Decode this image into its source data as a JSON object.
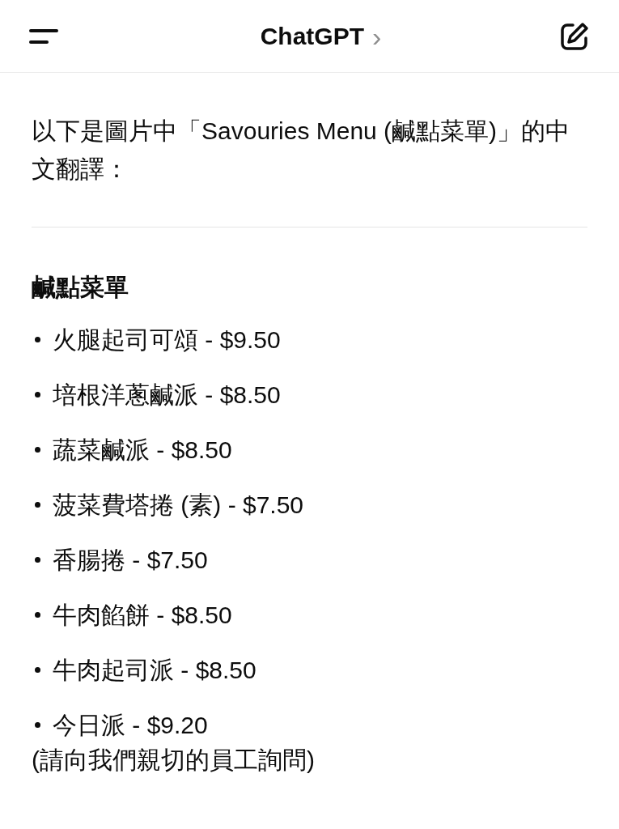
{
  "header": {
    "title": "ChatGPT",
    "chevron": "›"
  },
  "message": {
    "intro": "以下是圖片中「Savouries Menu (鹹點菜單)」的中文翻譯：",
    "heading": "鹹點菜單",
    "items": [
      {
        "text": "火腿起司可頌 - $9.50"
      },
      {
        "text": "培根洋蔥鹹派 - $8.50"
      },
      {
        "text": "蔬菜鹹派 - $8.50"
      },
      {
        "text": "菠菜費塔捲 (素) - $7.50"
      },
      {
        "text": "香腸捲 - $7.50"
      },
      {
        "text": "牛肉餡餅 - $8.50"
      },
      {
        "text": "牛肉起司派 - $8.50"
      },
      {
        "text": "今日派 - $9.20",
        "note": "(請向我們親切的員工詢問)"
      }
    ]
  }
}
